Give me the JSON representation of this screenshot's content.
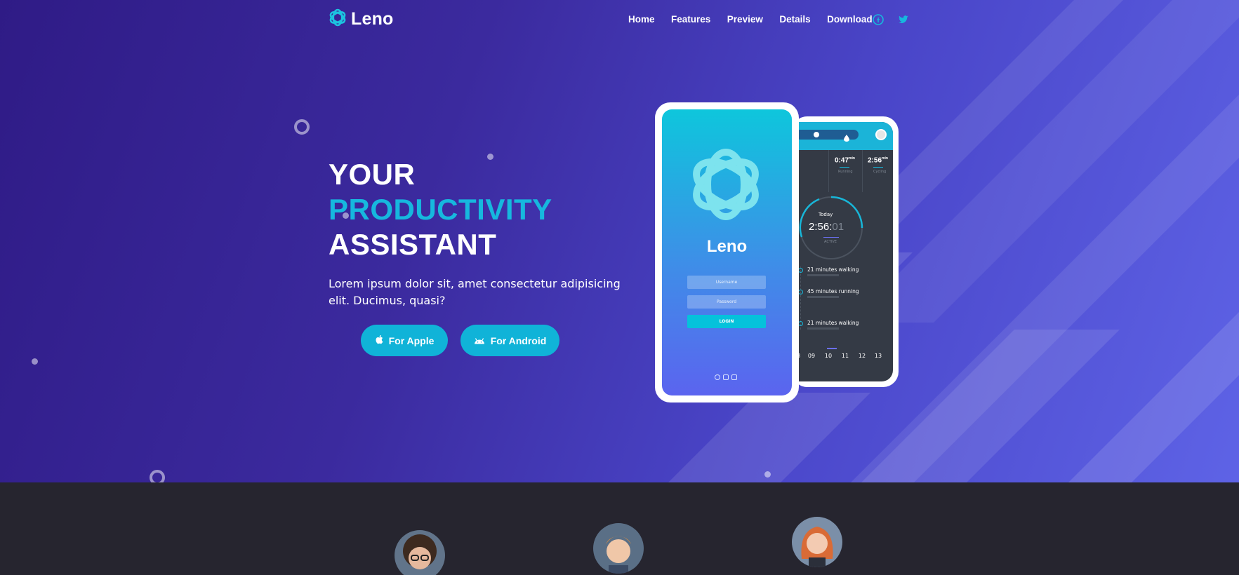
{
  "brand": {
    "name": "Leno"
  },
  "nav": {
    "items": [
      "Home",
      "Features",
      "Preview",
      "Details",
      "Download"
    ],
    "social": [
      "facebook-icon",
      "twitter-icon"
    ]
  },
  "hero": {
    "line1": "YOUR",
    "line2": "PRODUCTIVITY",
    "line3": "ASSISTANT",
    "description": "Lorem ipsum dolor sit, amet consectetur adipisicing elit. Ducimus, quasi?",
    "btn_apple": "For Apple",
    "btn_android": "For Android"
  },
  "phone_front": {
    "app_name": "Leno",
    "username_placeholder": "Username",
    "password_placeholder": "Password",
    "login_label": "LOGIN"
  },
  "phone_back": {
    "stats": [
      {
        "value": "0:47",
        "unit": "min",
        "label": "Running"
      },
      {
        "value": "2:56",
        "unit": "min",
        "label": "Cycling"
      }
    ],
    "today_label": "Today",
    "timer_main": "2:56:",
    "timer_faded": "01",
    "active_label": "ACTIVE",
    "activities": [
      "21 minutes walking",
      "45 minutes running",
      "21 minutes walking"
    ],
    "days": [
      "08",
      "09",
      "10",
      "11",
      "12",
      "13"
    ]
  },
  "colors": {
    "accent": "#10b3d8",
    "hero_start": "#2f1b86",
    "hero_end": "#5e63e6",
    "section_bg": "#26252f"
  }
}
